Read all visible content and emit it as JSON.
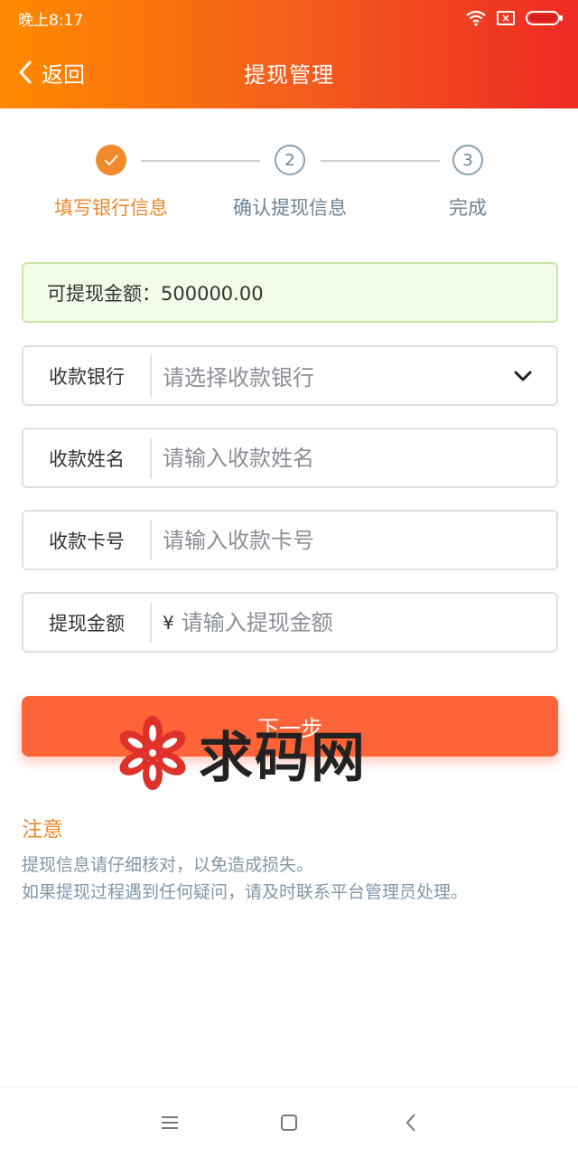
{
  "status_bar": {
    "time": "晚上8:17"
  },
  "header": {
    "back_label": "返回",
    "title": "提现管理"
  },
  "steps": [
    {
      "number": "✓",
      "label": "填写银行信息",
      "state": "done"
    },
    {
      "number": "2",
      "label": "确认提现信息",
      "state": "todo"
    },
    {
      "number": "3",
      "label": "完成",
      "state": "todo"
    }
  ],
  "balance": {
    "text": "可提现金额：500000.00"
  },
  "form": {
    "bank": {
      "label": "收款银行",
      "placeholder": "请选择收款银行"
    },
    "name": {
      "label": "收款姓名",
      "placeholder": "请输入收款姓名"
    },
    "card": {
      "label": "收款卡号",
      "placeholder": "请输入收款卡号"
    },
    "amount": {
      "label": "提现金额",
      "prefix": "¥",
      "placeholder": "请输入提现金额"
    }
  },
  "next_button": {
    "label": "下一步"
  },
  "watermark": {
    "text": "求码网"
  },
  "notes": {
    "title": "注意",
    "lines": [
      "提现信息请仔细核对，以免造成损失。",
      "如果提现过程遇到任何疑问，请及时联系平台管理员处理。"
    ]
  },
  "icons": {
    "back": "chevron-left-icon",
    "dropdown": "chevron-down-icon",
    "wifi": "wifi-icon",
    "sim": "no-sim-icon",
    "battery": "battery-icon",
    "menu": "menu-icon",
    "home": "home-square-icon",
    "nav_back": "nav-back-icon"
  },
  "colors": {
    "accent_orange": "#f08a2a",
    "button": "#ff6338",
    "notice_text": "#7f97a8",
    "header_start": "#ff8a00",
    "header_end": "#ee2a24"
  }
}
